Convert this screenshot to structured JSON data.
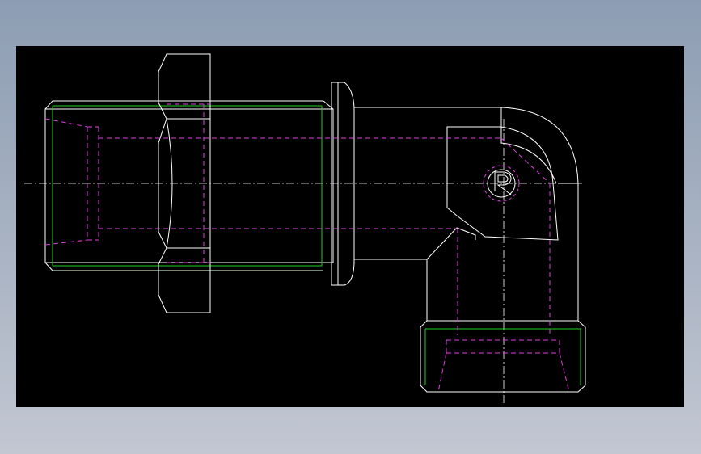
{
  "viewport": {
    "background": "#000000"
  },
  "colors": {
    "outline": "#ffffff",
    "hidden_lines": "#e040e0",
    "thread_lines": "#20d020",
    "centerline": "#ffffff"
  },
  "drawing": {
    "subject": "elbow-fitting-with-hex-nut",
    "view": "cad-section-view",
    "symbol": "R"
  }
}
